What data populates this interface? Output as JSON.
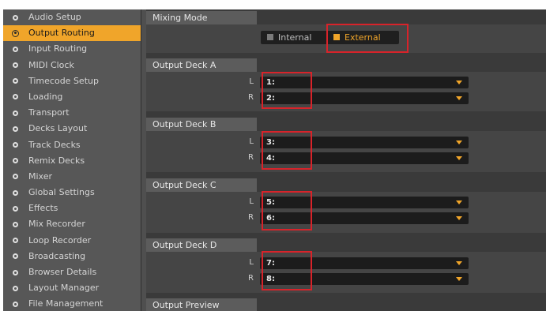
{
  "sidebar": {
    "items": [
      {
        "label": "Audio Setup",
        "active": false
      },
      {
        "label": "Output Routing",
        "active": true
      },
      {
        "label": "Input Routing",
        "active": false
      },
      {
        "label": "MIDI Clock",
        "active": false
      },
      {
        "label": "Timecode Setup",
        "active": false
      },
      {
        "label": "Loading",
        "active": false
      },
      {
        "label": "Transport",
        "active": false
      },
      {
        "label": "Decks Layout",
        "active": false
      },
      {
        "label": "Track Decks",
        "active": false
      },
      {
        "label": "Remix Decks",
        "active": false
      },
      {
        "label": "Mixer",
        "active": false
      },
      {
        "label": "Global Settings",
        "active": false
      },
      {
        "label": "Effects",
        "active": false
      },
      {
        "label": "Mix Recorder",
        "active": false
      },
      {
        "label": "Loop Recorder",
        "active": false
      },
      {
        "label": "Broadcasting",
        "active": false
      },
      {
        "label": "Browser Details",
        "active": false
      },
      {
        "label": "Layout Manager",
        "active": false
      },
      {
        "label": "File Management",
        "active": false
      }
    ]
  },
  "mixing_mode": {
    "header": "Mixing Mode",
    "options": [
      {
        "label": "Internal",
        "selected": false
      },
      {
        "label": "External",
        "selected": true
      }
    ]
  },
  "decks": [
    {
      "header": "Output Deck A",
      "left_label": "L",
      "left_value": "1:",
      "right_label": "R",
      "right_value": "2:"
    },
    {
      "header": "Output Deck B",
      "left_label": "L",
      "left_value": "3:",
      "right_label": "R",
      "right_value": "4:"
    },
    {
      "header": "Output Deck C",
      "left_label": "L",
      "left_value": "5:",
      "right_label": "R",
      "right_value": "6:"
    },
    {
      "header": "Output Deck D",
      "left_label": "L",
      "left_value": "7:",
      "right_label": "R",
      "right_value": "8:"
    }
  ],
  "preview": {
    "header": "Output Preview"
  },
  "colors": {
    "accent": "#f0a52a",
    "highlight": "#d8232a",
    "sidebar_bg": "#575757",
    "panel_bg": "#454545"
  },
  "icons": {
    "sidebar_bullet": "radio-bullet-icon",
    "dropdown_arrow": "chevron-down-icon"
  }
}
